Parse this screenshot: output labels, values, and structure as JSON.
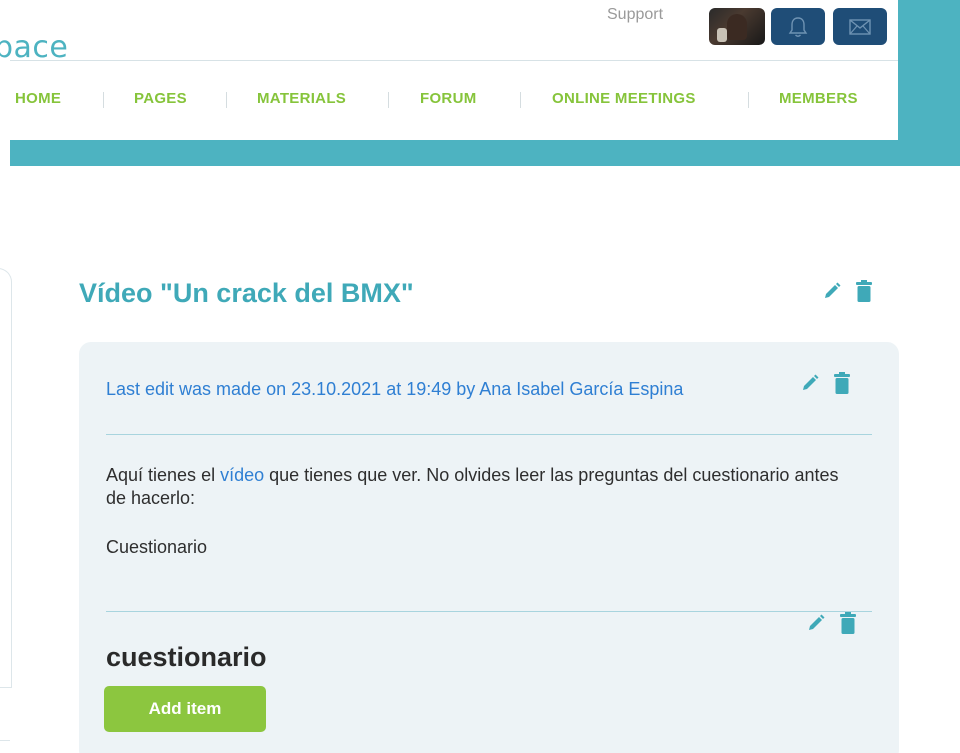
{
  "header": {
    "logo_text": "pace",
    "support_label": "Support",
    "avatar_icon": "avatar-photo",
    "notifications_icon": "bell-icon",
    "messages_icon": "envelope-icon"
  },
  "nav": {
    "items": [
      {
        "label": "HOME"
      },
      {
        "label": "PAGES"
      },
      {
        "label": "MATERIALS"
      },
      {
        "label": "FORUM"
      },
      {
        "label": "ONLINE MEETINGS"
      },
      {
        "label": "MEMBERS"
      }
    ]
  },
  "page": {
    "title": "Vídeo \"Un crack del BMX\""
  },
  "entry": {
    "last_edit": "Last edit was made on 23.10.2021 at 19:49 by Ana Isabel García Espina",
    "body_prefix": "Aquí tienes el ",
    "body_link": "vídeo",
    "body_suffix": " que tienes que ver. No olvides leer las preguntas del cuestionario antes de hacerlo:",
    "body_line2": "Cuestionario"
  },
  "subsection": {
    "title": "cuestionario",
    "add_button": "Add item"
  },
  "colors": {
    "accent_teal": "#4db3c1",
    "nav_green": "#86c43b",
    "button_green": "#8cc63f",
    "link_blue": "#2f7fd3",
    "header_button_navy": "#1f4d77",
    "content_bg": "#edf3f6"
  }
}
